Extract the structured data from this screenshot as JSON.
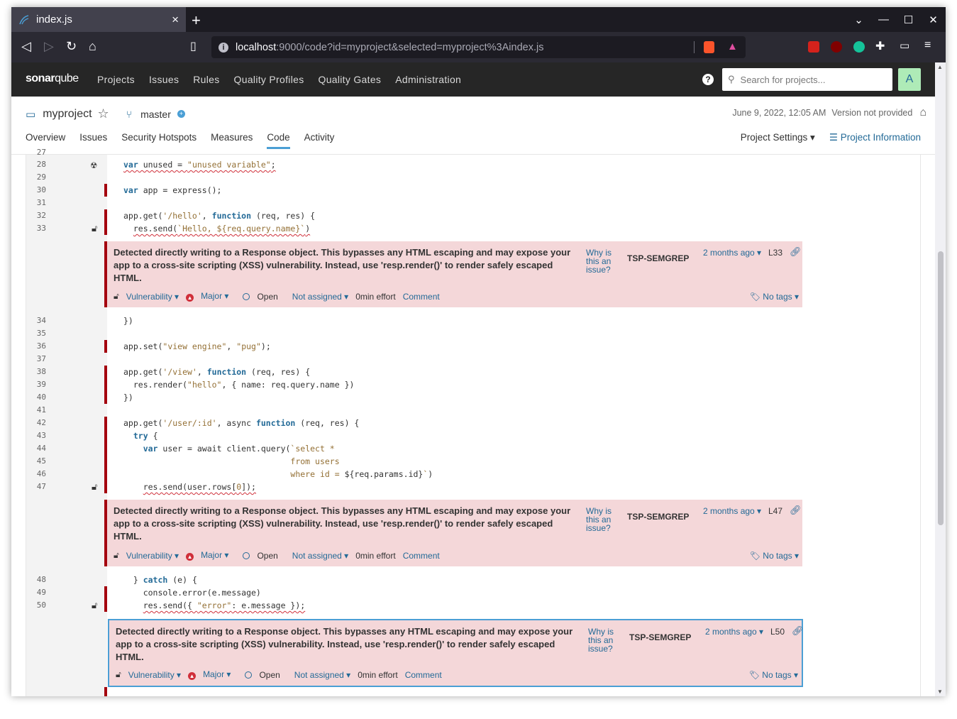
{
  "browser": {
    "tab_title": "index.js",
    "tab_close": "×",
    "new_tab": "+",
    "url_host": "localhost",
    "url_path": ":9000/code?id=myproject&selected=myproject%3Aindex.js"
  },
  "nav": {
    "logo_bold": "sonar",
    "logo_light": "qube",
    "links": [
      "Projects",
      "Issues",
      "Rules",
      "Quality Profiles",
      "Quality Gates",
      "Administration"
    ],
    "help": "?",
    "search_placeholder": "Search for projects...",
    "avatar_letter": "A"
  },
  "project": {
    "name": "myproject",
    "branch": "master",
    "date": "June 9, 2022, 12:05 AM",
    "version": "Version not provided",
    "tabs": [
      "Overview",
      "Issues",
      "Security Hotspots",
      "Measures",
      "Code",
      "Activity"
    ],
    "active_tab": "Code",
    "settings": "Project Settings ▾",
    "information": "Project Information"
  },
  "code_lines": [
    {
      "n": "27",
      "code": ""
    },
    {
      "n": "28",
      "code": "var unused = \"unused variable\";"
    },
    {
      "n": "29",
      "code": ""
    },
    {
      "n": "30",
      "code": "var app = express();"
    },
    {
      "n": "31",
      "code": ""
    },
    {
      "n": "32",
      "code": "app.get('/hello', function (req, res) {"
    },
    {
      "n": "33",
      "code": "  res.send(`Hello, ${req.query.name}`)"
    },
    {
      "n": "34",
      "code": "})"
    },
    {
      "n": "35",
      "code": ""
    },
    {
      "n": "36",
      "code": "app.set(\"view engine\", \"pug\");"
    },
    {
      "n": "37",
      "code": ""
    },
    {
      "n": "38",
      "code": "app.get('/view', function (req, res) {"
    },
    {
      "n": "39",
      "code": "  res.render(\"hello\", { name: req.query.name })"
    },
    {
      "n": "40",
      "code": "})"
    },
    {
      "n": "41",
      "code": ""
    },
    {
      "n": "42",
      "code": "app.get('/user/:id', async function (req, res) {"
    },
    {
      "n": "43",
      "code": "  try {"
    },
    {
      "n": "44",
      "code": "    var user = await client.query(`select *"
    },
    {
      "n": "45",
      "code": "                                  from users"
    },
    {
      "n": "46",
      "code": "                                  where id = ${req.params.id}`)"
    },
    {
      "n": "47",
      "code": "    res.send(user.rows[0]);"
    },
    {
      "n": "48",
      "code": "  } catch (e) {"
    },
    {
      "n": "49",
      "code": "    console.error(e.message)"
    },
    {
      "n": "50",
      "code": "    res.send({ \"error\": e.message });"
    }
  ],
  "issues": [
    {
      "message": "Detected directly writing to a Response object. This bypasses any HTML escaping and may expose your app to a cross-site scripting (XSS) vulnerability. Instead, use 'resp.render()' to render safely escaped HTML.",
      "why": "Why is this an issue?",
      "rule": "TSP-SEMGREP",
      "date": "2 months ago ▾",
      "line": "L33",
      "type": "Vulnerability ▾",
      "severity": "Major ▾",
      "status": "Open",
      "assignee": "Not assigned ▾",
      "effort": "0min effort",
      "comment": "Comment",
      "tags": "No tags ▾"
    },
    {
      "message": "Detected directly writing to a Response object. This bypasses any HTML escaping and may expose your app to a cross-site scripting (XSS) vulnerability. Instead, use 'resp.render()' to render safely escaped HTML.",
      "why": "Why is this an issue?",
      "rule": "TSP-SEMGREP",
      "date": "2 months ago ▾",
      "line": "L47",
      "type": "Vulnerability ▾",
      "severity": "Major ▾",
      "status": "Open",
      "assignee": "Not assigned ▾",
      "effort": "0min effort",
      "comment": "Comment",
      "tags": "No tags ▾"
    },
    {
      "message": "Detected directly writing to a Response object. This bypasses any HTML escaping and may expose your app to a cross-site scripting (XSS) vulnerability. Instead, use 'resp.render()' to render safely escaped HTML.",
      "why": "Why is this an issue?",
      "rule": "TSP-SEMGREP",
      "date": "2 months ago ▾",
      "line": "L50",
      "type": "Vulnerability ▾",
      "severity": "Major ▾",
      "status": "Open",
      "assignee": "Not assigned ▾",
      "effort": "0min effort",
      "comment": "Comment",
      "tags": "No tags ▾"
    }
  ],
  "colors": {
    "issue_bg": "#f4d7d9",
    "issue_bar": "#a4030f",
    "link": "#236a97",
    "header": "#262626"
  }
}
